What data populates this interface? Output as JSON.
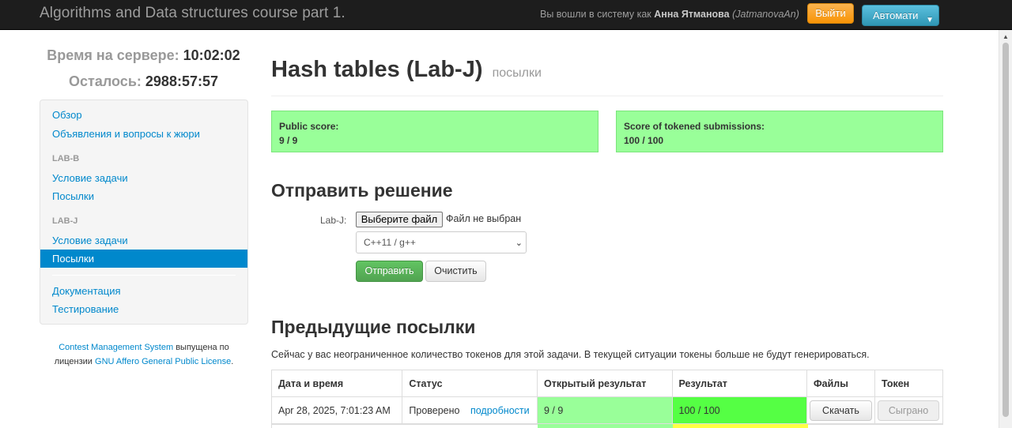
{
  "navbar": {
    "brand": "Algorithms and Data structures course part 1.",
    "logged_in_prefix": "Вы вошли в систему как",
    "user_name": "Анна Ятманова",
    "user_login": "(JatmanovaAn)",
    "logout_label": "Выйти",
    "auto_label": "Автомати"
  },
  "sidebar": {
    "server_time_label": "Время на сервере:",
    "server_time_value": "10:02:02",
    "remaining_label": "Осталось:",
    "remaining_value": "2988:57:57",
    "items": {
      "overview": "Обзор",
      "announcements": "Объявления и вопросы к жюри",
      "lab_b_header": "LAB-B",
      "lab_b_statement": "Условие задачи",
      "lab_b_submissions": "Посылки",
      "lab_j_header": "LAB-J",
      "lab_j_statement": "Условие задачи",
      "lab_j_submissions": "Посылки",
      "documentation": "Документация",
      "testing": "Тестирование"
    },
    "license": {
      "cms_link": "Contest Management System",
      "text1": "выпущена по лицензии",
      "license_link": "GNU Affero General Public License",
      "text2": "."
    }
  },
  "main": {
    "title": "Hash tables (Lab-J)",
    "subtitle": "посылки",
    "public_score_label": "Public score:",
    "public_score_value": "9 / 9",
    "tokened_score_label": "Score of tokened submissions:",
    "tokened_score_value": "100 / 100",
    "submit_heading": "Отправить решение",
    "file_label": "Lab-J:",
    "file_button": "Выберите файл",
    "file_none": "Файл не выбран",
    "language_selected": "C++11 / g++",
    "send_label": "Отправить",
    "clear_label": "Очистить",
    "previous_heading": "Предыдущие посылки",
    "tokens_note": "Сейчас у вас неограниченное количество токенов для этой задачи. В текущей ситуации токены больше не будут генерироваться.",
    "table": {
      "headers": [
        "Дата и время",
        "Статус",
        "Открытый результат",
        "Результат",
        "Файлы",
        "Токен"
      ],
      "rows": [
        {
          "date": "Apr 28, 2025, 7:01:23 AM",
          "status": "Проверено",
          "details_link": "подробности",
          "public_result": "9 / 9",
          "result": "100 / 100",
          "download_label": "Скачать",
          "token_label": "Сыграно"
        }
      ]
    }
  },
  "colors": {
    "navbar_bg": "#1d1d1d",
    "link": "#0088cc",
    "score_box_bg": "#99ff99",
    "result_full_bg": "#55ff44",
    "next_row_partial_bg": "#ffff44",
    "logout_btn": "#f89406",
    "auto_btn": "#2f96b4",
    "send_btn": "#51a351"
  }
}
